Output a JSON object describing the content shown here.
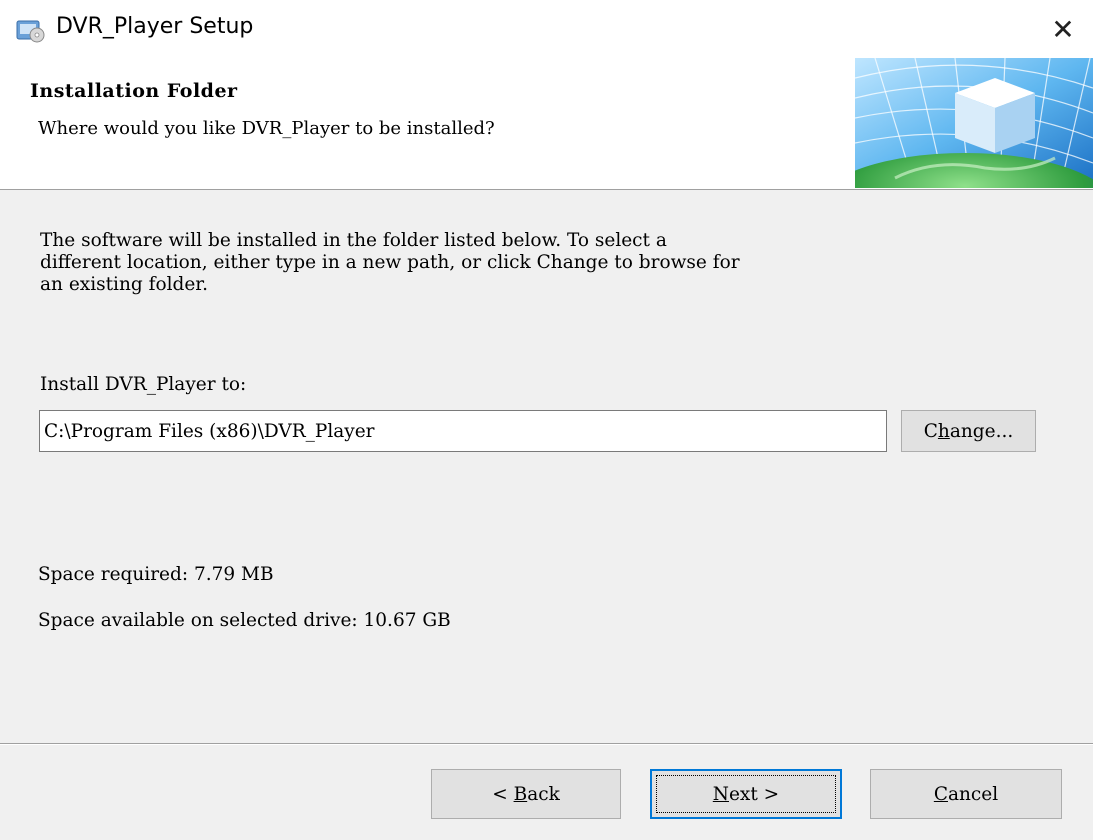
{
  "window": {
    "title": "DVR_Player Setup",
    "close_symbol": "✕",
    "icon": "installer-app-icon"
  },
  "header": {
    "title": "Installation Folder",
    "subtitle": "Where would you like DVR_Player to be installed?",
    "banner_icon": "globe-cube-banner"
  },
  "body": {
    "description": "The software will be installed in the folder listed below. To select a\ndifferent location, either type in a new path, or click Change to browse for\nan existing folder.",
    "install_label": "Install DVR_Player to:",
    "install_path": "C:\\Program Files (x86)\\DVR_Player",
    "change_button": {
      "pre": "C",
      "mnemonic": "h",
      "post": "ange..."
    },
    "space_required": "Space required: 7.79 MB",
    "space_available": "Space available on selected drive: 10.67 GB"
  },
  "footer": {
    "back_button": {
      "pre": "< ",
      "mnemonic": "B",
      "post": "ack"
    },
    "next_button": {
      "pre": "",
      "mnemonic": "N",
      "post": "ext >"
    },
    "cancel_button": {
      "pre": "",
      "mnemonic": "C",
      "post": "ancel"
    }
  },
  "colors": {
    "focus_border": "#0078d7",
    "dialog_bg": "#f0f0f0",
    "button_bg": "#e1e1e1"
  }
}
